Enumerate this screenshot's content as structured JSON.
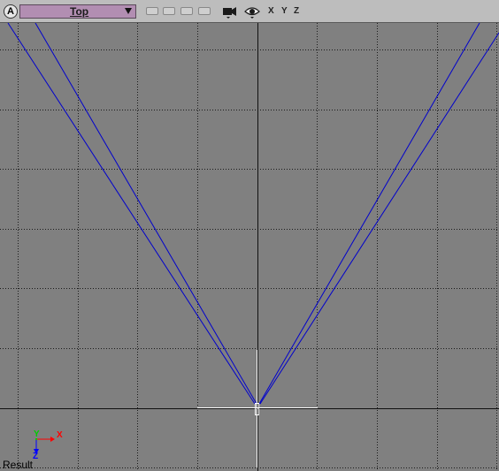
{
  "toolbar": {
    "mode_icon": "A",
    "view_label": "Top",
    "axes": [
      "X",
      "Y",
      "Z"
    ],
    "icons": [
      "camera-icon",
      "eye-icon"
    ]
  },
  "viewport": {
    "status_label": "Result",
    "gizmo": {
      "x_label": "X",
      "y_label": "Y",
      "z_label": "Z"
    }
  },
  "colors": {
    "background": "#808080",
    "grid": "#1a1a1a",
    "frustum": "#0000cc",
    "crosshair": "#ffffff",
    "axis_x": "#ff0000",
    "axis_y": "#00cc00",
    "axis_z": "#0000ff"
  }
}
